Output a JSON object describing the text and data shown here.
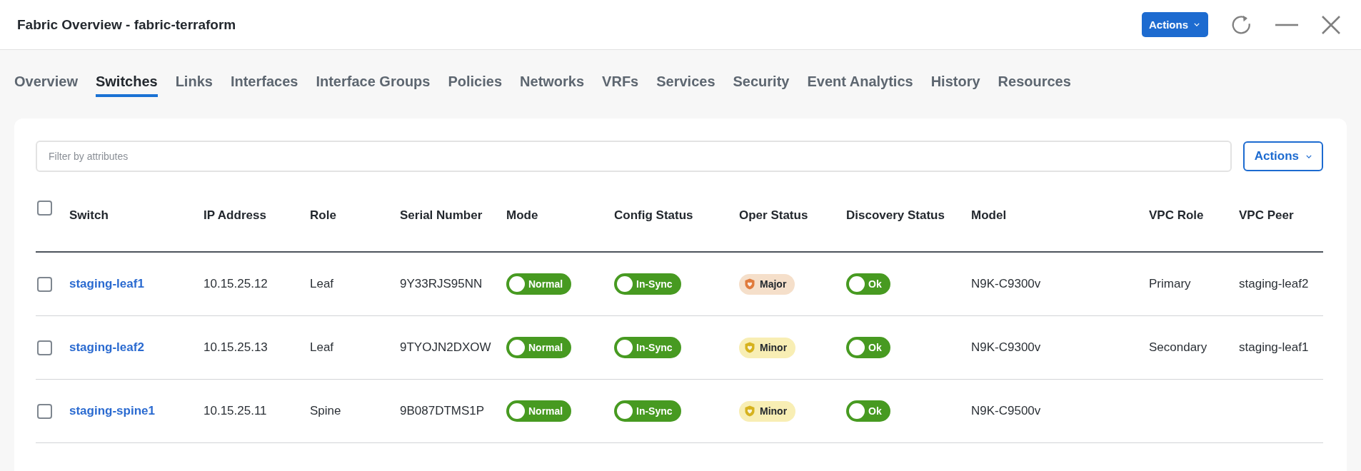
{
  "window": {
    "title": "Fabric Overview - fabric-terraform"
  },
  "header_actions": {
    "label": "Actions"
  },
  "tabs": [
    {
      "label": "Overview",
      "selected": false
    },
    {
      "label": "Switches",
      "selected": true
    },
    {
      "label": "Links",
      "selected": false
    },
    {
      "label": "Interfaces",
      "selected": false
    },
    {
      "label": "Interface Groups",
      "selected": false
    },
    {
      "label": "Policies",
      "selected": false
    },
    {
      "label": "Networks",
      "selected": false
    },
    {
      "label": "VRFs",
      "selected": false
    },
    {
      "label": "Services",
      "selected": false
    },
    {
      "label": "Security",
      "selected": false
    },
    {
      "label": "Event Analytics",
      "selected": false
    },
    {
      "label": "History",
      "selected": false
    },
    {
      "label": "Resources",
      "selected": false
    }
  ],
  "filter": {
    "placeholder": "Filter by attributes"
  },
  "table_actions": {
    "label": "Actions"
  },
  "table": {
    "select_all": {
      "checked": false
    },
    "columns": [
      "Switch",
      "IP Address",
      "Role",
      "Serial Number",
      "Mode",
      "Config Status",
      "Oper Status",
      "Discovery Status",
      "Model",
      "VPC Role",
      "VPC Peer"
    ],
    "rows": [
      {
        "checked": false,
        "switch": "staging-leaf1",
        "ip_address": "10.15.25.12",
        "role": "Leaf",
        "serial_number": "9Y33RJS95NN",
        "mode": "Normal",
        "config_status": "In-Sync",
        "oper_status": {
          "label": "Major",
          "kind": "major"
        },
        "discovery_status": "Ok",
        "model": "N9K-C9300v",
        "vpc_role": "Primary",
        "vpc_peer": "staging-leaf2"
      },
      {
        "checked": false,
        "switch": "staging-leaf2",
        "ip_address": "10.15.25.13",
        "role": "Leaf",
        "serial_number": "9TYOJN2DXOW",
        "mode": "Normal",
        "config_status": "In-Sync",
        "oper_status": {
          "label": "Minor",
          "kind": "minor"
        },
        "discovery_status": "Ok",
        "model": "N9K-C9300v",
        "vpc_role": "Secondary",
        "vpc_peer": "staging-leaf1"
      },
      {
        "checked": false,
        "switch": "staging-spine1",
        "ip_address": "10.15.25.11",
        "role": "Spine",
        "serial_number": "9B087DTMS1P",
        "mode": "Normal",
        "config_status": "In-Sync",
        "oper_status": {
          "label": "Minor",
          "kind": "minor"
        },
        "discovery_status": "Ok",
        "model": "N9K-C9500v"
      }
    ]
  }
}
